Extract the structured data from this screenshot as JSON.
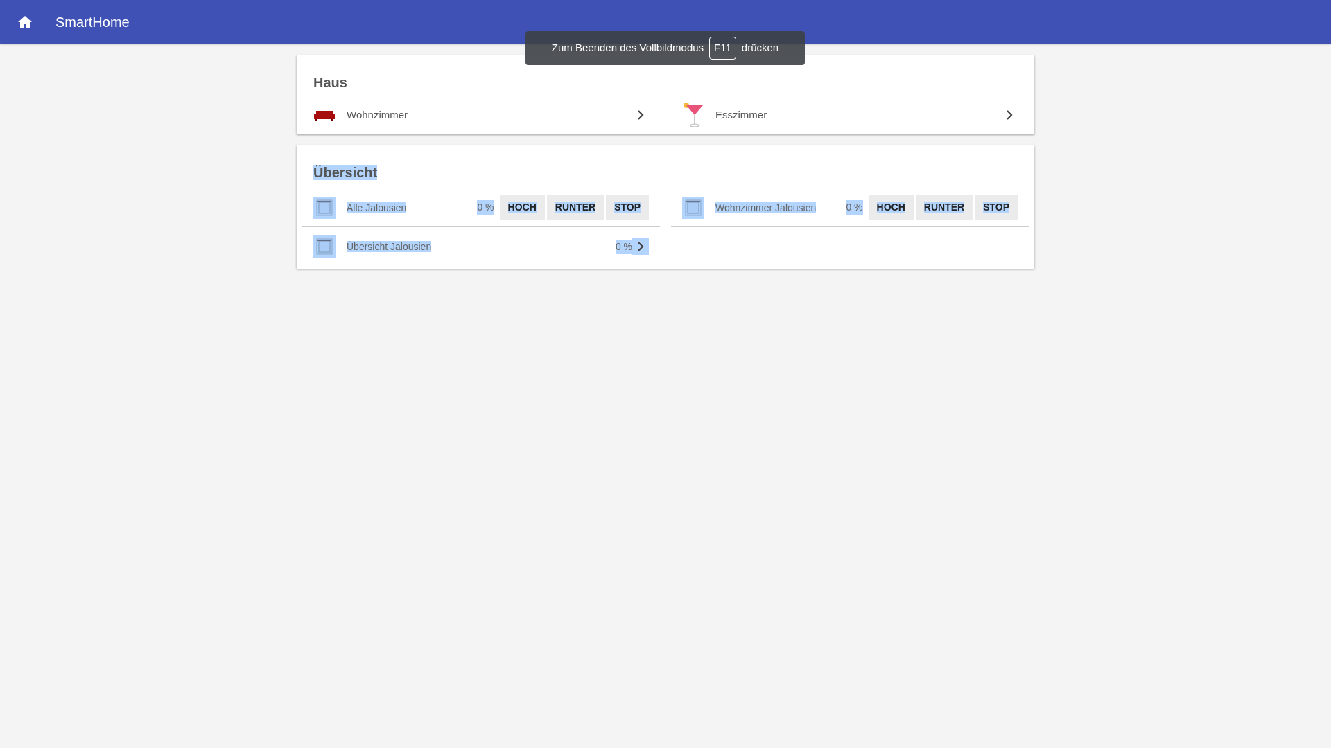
{
  "app_bar": {
    "title": "SmartHome"
  },
  "toast": {
    "before": "Zum Beenden des Vollbildmodus",
    "key": "F11",
    "after": "drücken"
  },
  "cards": [
    {
      "title": "Haus",
      "text_selected": false,
      "items": [
        {
          "kind": "room",
          "name": "Wohnzimmer"
        },
        {
          "kind": "room",
          "name": "Esszimmer"
        }
      ]
    },
    {
      "title": "Übersicht",
      "text_selected": true,
      "items": [
        {
          "kind": "shutter",
          "name": "Alle Jalousien",
          "value": "0 %",
          "buttons": [
            "HOCH",
            "RUNTER",
            "STOP"
          ]
        },
        {
          "kind": "shutter",
          "name": "Wohnzimmer Jalousien",
          "value": "0 %",
          "buttons": [
            "HOCH",
            "RUNTER",
            "STOP"
          ]
        },
        {
          "kind": "link",
          "name": "Übersicht Jalousien",
          "value": "0 %"
        }
      ]
    }
  ]
}
